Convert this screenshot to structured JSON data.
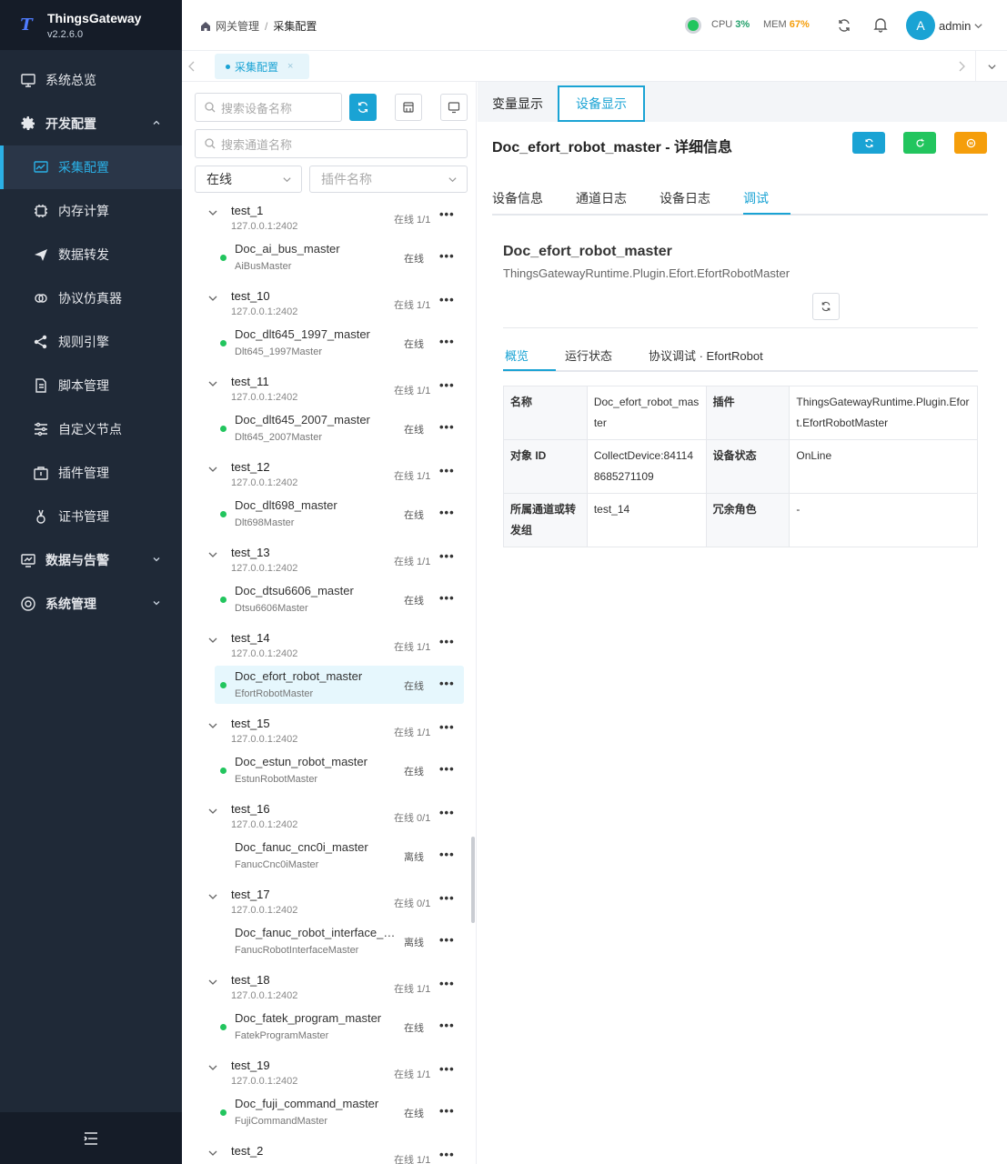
{
  "brand": {
    "name": "ThingsGateway",
    "version": "v2.2.6.0",
    "logo": "T"
  },
  "nav": {
    "overview": "系统总览",
    "dev_config": "开发配置",
    "collect_config": "采集配置",
    "memory_calc": "内存计算",
    "data_forward": "数据转发",
    "protocol_sim": "协议仿真器",
    "rule_engine": "规则引擎",
    "script_mgmt": "脚本管理",
    "custom_node": "自定义节点",
    "plugin_mgmt": "插件管理",
    "cert_mgmt": "证书管理",
    "data_alarm": "数据与告警",
    "sys_mgmt": "系统管理"
  },
  "header": {
    "breadcrumb_root": "网关管理",
    "breadcrumb_sep": "/",
    "breadcrumb_current": "采集配置",
    "cpu_label": "CPU",
    "cpu_value": "3%",
    "mem_label": "MEM",
    "mem_value": "67%",
    "avatar_letter": "A",
    "username": "admin",
    "colors": {
      "accent": "#1aa3d4",
      "cpu": "#22a06b",
      "mem": "#f59e0b"
    }
  },
  "tabstrip": {
    "active_tab": "采集配置",
    "close": "×"
  },
  "left": {
    "device_search_placeholder": "搜索设备名称",
    "channel_search_placeholder": "搜索通道名称",
    "status_select": "在线",
    "plugin_select_placeholder": "插件名称",
    "groups": [
      {
        "name": "test_1",
        "ip": "127.0.0.1:2402",
        "status": "在线 1/1",
        "device": {
          "name": "Doc_ai_bus_master",
          "plugin": "AiBusMaster",
          "status": "在线",
          "online": true
        }
      },
      {
        "name": "test_10",
        "ip": "127.0.0.1:2402",
        "status": "在线 1/1",
        "device": {
          "name": "Doc_dlt645_1997_master",
          "plugin": "Dlt645_1997Master",
          "status": "在线",
          "online": true
        }
      },
      {
        "name": "test_11",
        "ip": "127.0.0.1:2402",
        "status": "在线 1/1",
        "device": {
          "name": "Doc_dlt645_2007_master",
          "plugin": "Dlt645_2007Master",
          "status": "在线",
          "online": true
        }
      },
      {
        "name": "test_12",
        "ip": "127.0.0.1:2402",
        "status": "在线 1/1",
        "device": {
          "name": "Doc_dlt698_master",
          "plugin": "Dlt698Master",
          "status": "在线",
          "online": true
        }
      },
      {
        "name": "test_13",
        "ip": "127.0.0.1:2402",
        "status": "在线 1/1",
        "device": {
          "name": "Doc_dtsu6606_master",
          "plugin": "Dtsu6606Master",
          "status": "在线",
          "online": true
        }
      },
      {
        "name": "test_14",
        "ip": "127.0.0.1:2402",
        "status": "在线 1/1",
        "device": {
          "name": "Doc_efort_robot_master",
          "plugin": "EfortRobotMaster",
          "status": "在线",
          "online": true,
          "selected": true
        }
      },
      {
        "name": "test_15",
        "ip": "127.0.0.1:2402",
        "status": "在线 1/1",
        "device": {
          "name": "Doc_estun_robot_master",
          "plugin": "EstunRobotMaster",
          "status": "在线",
          "online": true
        }
      },
      {
        "name": "test_16",
        "ip": "127.0.0.1:2402",
        "status": "在线 0/1",
        "device": {
          "name": "Doc_fanuc_cnc0i_master",
          "plugin": "FanucCnc0iMaster",
          "status": "离线",
          "online": false
        }
      },
      {
        "name": "test_17",
        "ip": "127.0.0.1:2402",
        "status": "在线 0/1",
        "device": {
          "name": "Doc_fanuc_robot_interface_m...",
          "plugin": "FanucRobotInterfaceMaster",
          "status": "离线",
          "online": false
        }
      },
      {
        "name": "test_18",
        "ip": "127.0.0.1:2402",
        "status": "在线 1/1",
        "device": {
          "name": "Doc_fatek_program_master",
          "plugin": "FatekProgramMaster",
          "status": "在线",
          "online": true
        }
      },
      {
        "name": "test_19",
        "ip": "127.0.0.1:2402",
        "status": "在线 1/1",
        "device": {
          "name": "Doc_fuji_command_master",
          "plugin": "FujiCommandMaster",
          "status": "在线",
          "online": true
        }
      },
      {
        "name": "test_2",
        "ip": "",
        "status": "在线 1/1",
        "device": null
      }
    ]
  },
  "right": {
    "view_tabs": [
      "变量显示",
      "设备显示"
    ],
    "title": "Doc_efort_robot_master - 详细信息",
    "info_tabs": [
      "设备信息",
      "通道日志",
      "设备日志",
      "调试"
    ],
    "device_name": "Doc_efort_robot_master",
    "device_plugin": "ThingsGatewayRuntime.Plugin.Efort.EfortRobotMaster",
    "sub_tabs": [
      "概览",
      "运行状态",
      "协议调试 · EfortRobot"
    ],
    "table": {
      "r1": {
        "k1": "名称",
        "v1": "Doc_efort_robot_master",
        "k2": "插件",
        "v2": "ThingsGatewayRuntime.Plugin.Efort.EfortRobotMaster"
      },
      "r2": {
        "k1": "对象 ID",
        "v1": "CollectDevice:841148685271109",
        "k2": "设备状态",
        "v2": "OnLine"
      },
      "r3": {
        "k1": "所属通道或转发组",
        "v1": "test_14",
        "k2": "冗余角色",
        "v2": "-"
      }
    },
    "button_colors": {
      "cyan": "#1aa3d4",
      "green": "#22c55e",
      "orange": "#f59e0b"
    }
  }
}
